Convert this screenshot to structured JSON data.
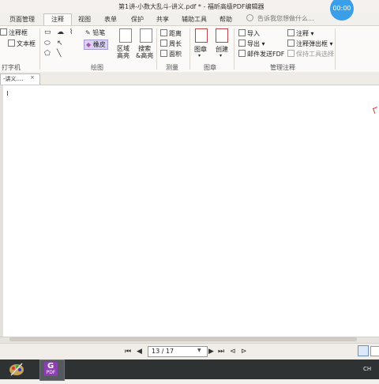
{
  "window": {
    "title": "第1讲-小数大乱斗-讲义.pdf * - 福昕高级PDF编辑器",
    "clock": "00:00"
  },
  "tabs": [
    {
      "label": "页面管理"
    },
    {
      "label": "注释",
      "active": true
    },
    {
      "label": "视图"
    },
    {
      "label": "表单"
    },
    {
      "label": "保护"
    },
    {
      "label": "共享"
    },
    {
      "label": "辅助工具"
    },
    {
      "label": "帮助"
    }
  ],
  "tell_me": {
    "placeholder": "告诉我您想做什么..."
  },
  "ribbon": {
    "typewriter": {
      "note_box": "注释框",
      "text_box": "文本框",
      "group": "打字机"
    },
    "drawing": {
      "pencil": "铅笔",
      "eraser": "橡皮",
      "group": "绘图"
    },
    "area_highlight": "区域\n高亮",
    "search_highlight": "搜索\n&高亮",
    "measure": {
      "distance": "距离",
      "perimeter": "周长",
      "area": "面积",
      "group": "测量"
    },
    "stamp": {
      "stamp": "图章",
      "create": "创建",
      "group": "图章"
    },
    "manage": {
      "import": "导入",
      "export": "导出",
      "email_fdf": "邮件发送FDF",
      "comments": "注释",
      "popup": "注释弹出框",
      "keep_tool": "保持工具选择",
      "group": "管理注释"
    }
  },
  "document_tab": {
    "label": "-讲义....",
    "close": "×"
  },
  "navigation": {
    "current_page": "13",
    "total_pages": "17",
    "page_text": "13 / 17"
  },
  "taskbar": {
    "app_label": "PDF",
    "ime": "CH"
  }
}
